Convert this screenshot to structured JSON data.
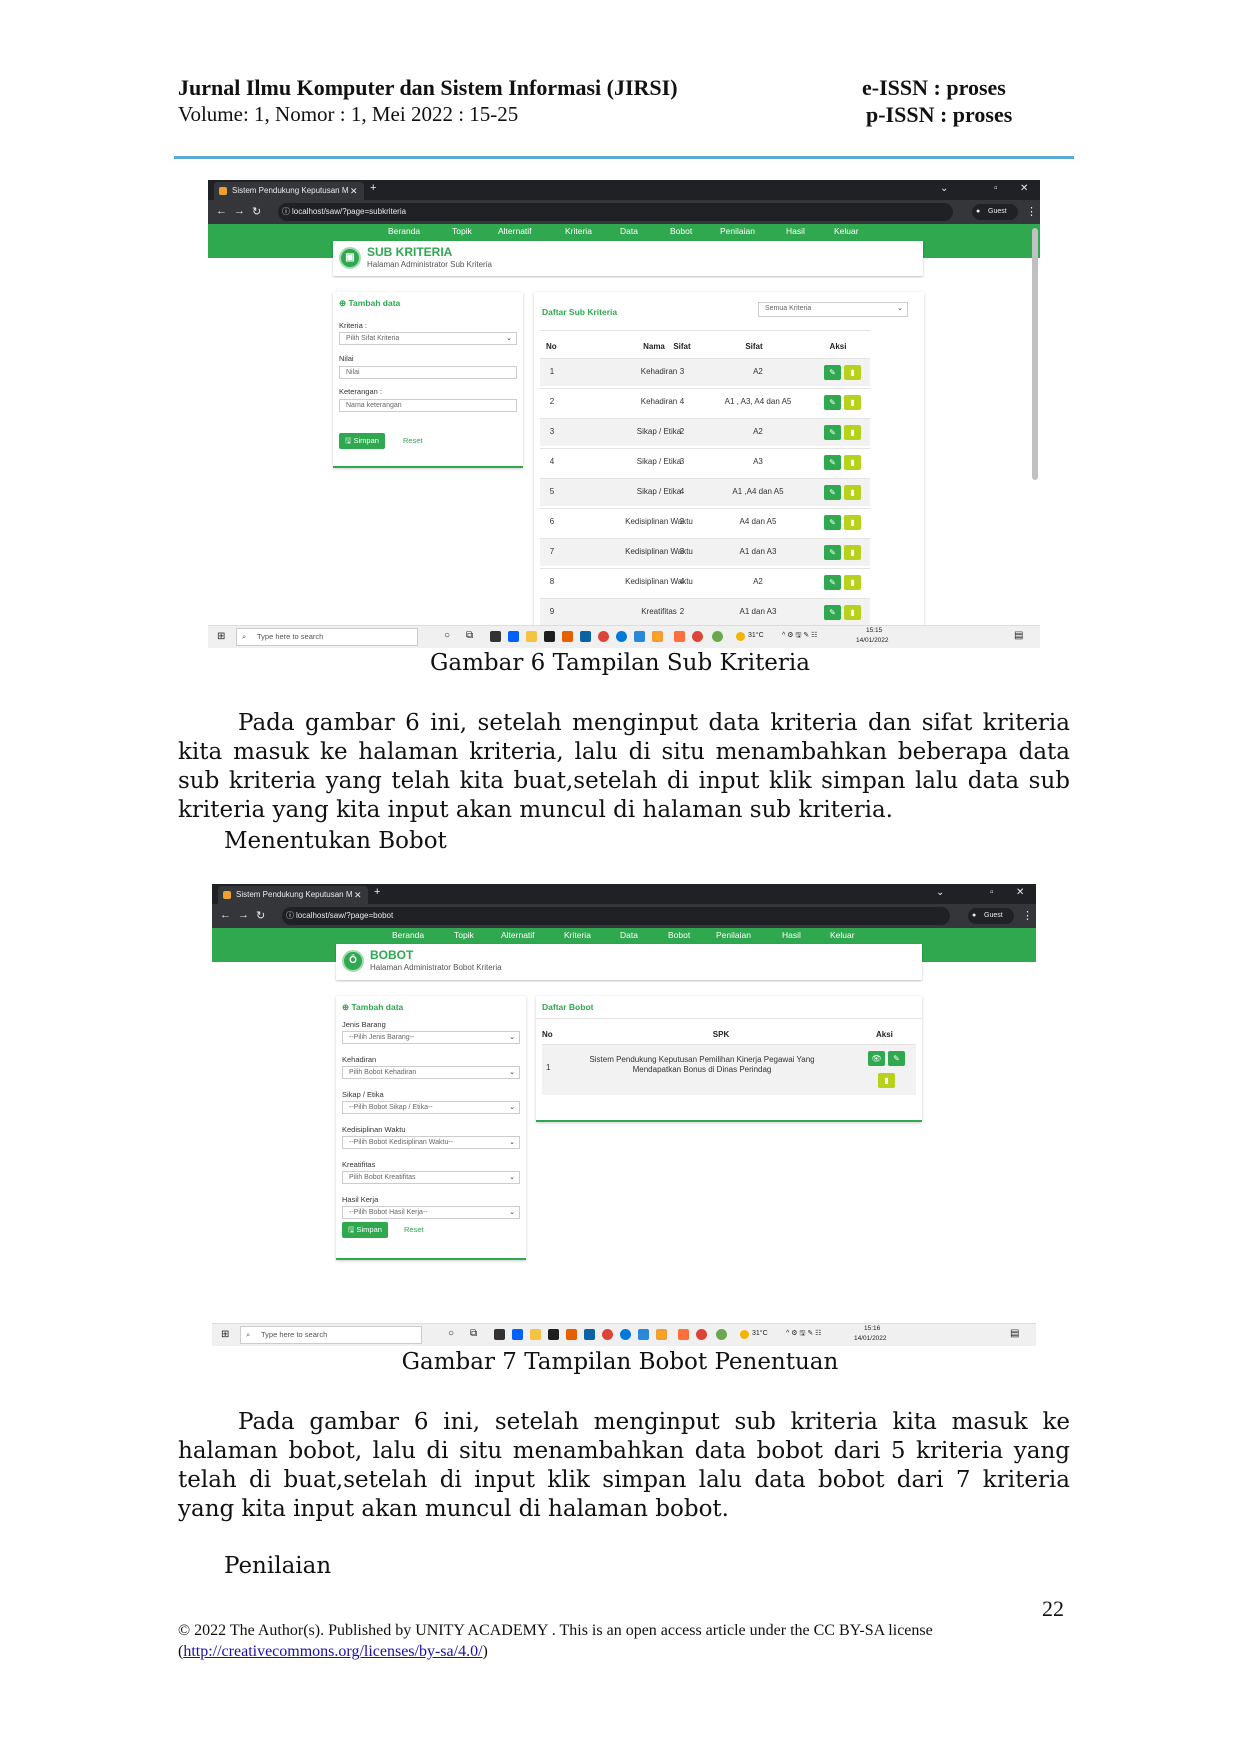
{
  "header": {
    "journal": "Jurnal Ilmu Komputer dan Sistem Informasi (JIRSI)",
    "volume": "Volume: 1, Nomor : 1, Mei 2022 : 15-25",
    "eissn": "e-ISSN : proses",
    "pissn": "p-ISSN : proses"
  },
  "shot1": {
    "tab_title": "Sistem Pendukung Keputusan M",
    "url": "localhost/saw/?page=subkriteria",
    "profile": "Guest",
    "menu": [
      "Beranda",
      "Topik",
      "Alternatif",
      "Kriteria",
      "Data",
      "Bobot",
      "Penilaian",
      "Hasil",
      "Keluar"
    ],
    "page_title": "SUB KRITERIA",
    "page_subtitle": "Halaman Administrator Sub Kriteria",
    "form": {
      "title": "Tambah data",
      "kriteria_label": "Kriteria :",
      "kriteria_value": "Pilih Sifat Kriteria",
      "nilai_label": "Nilai",
      "nilai_placeholder": "Nilai",
      "keterangan_label": "Keterangan :",
      "keterangan_placeholder": "Nama keterangan",
      "save": "Simpan",
      "reset": "Reset"
    },
    "list_title": "Daftar Sub Kriteria",
    "filter_value": "Semua Kriteria",
    "columns": [
      "No",
      "Nama",
      "Sifat",
      "Sifat",
      "Aksi"
    ],
    "rows": [
      {
        "no": "1",
        "nama": "Kehadiran",
        "nilai": "3",
        "sifat": "A2"
      },
      {
        "no": "2",
        "nama": "Kehadiran",
        "nilai": "4",
        "sifat": "A1 , A3, A4 dan A5"
      },
      {
        "no": "3",
        "nama": "Sikap / Etika",
        "nilai": "2",
        "sifat": "A2"
      },
      {
        "no": "4",
        "nama": "Sikap / Etika",
        "nilai": "3",
        "sifat": "A3"
      },
      {
        "no": "5",
        "nama": "Sikap / Etika",
        "nilai": "4",
        "sifat": "A1 ,A4 dan A5"
      },
      {
        "no": "6",
        "nama": "Kedisiplinan Waktu",
        "nilai": "2",
        "sifat": "A4 dan A5"
      },
      {
        "no": "7",
        "nama": "Kedisiplinan Waktu",
        "nilai": "3",
        "sifat": "A1 dan A3"
      },
      {
        "no": "8",
        "nama": "Kedisiplinan Waktu",
        "nilai": "4",
        "sifat": "A2"
      },
      {
        "no": "9",
        "nama": "Kreatifitas",
        "nilai": "2",
        "sifat": "A1 dan A3"
      }
    ],
    "taskbar": {
      "search": "Type here to search",
      "temp": "31°C",
      "time": "15:15",
      "date": "14/01/2022"
    }
  },
  "caption1": "Gambar 6 Tampilan Sub Kriteria",
  "para1": "Pada gambar 6 ini, setelah menginput data kriteria dan sifat kriteria kita masuk ke halaman kriteria, lalu di situ  menambahkan beberapa data sub kriteria yang telah kita buat,setelah di input klik simpan lalu data sub kriteria yang kita input akan muncul di halaman sub kriteria.",
  "heading1": "Menentukan Bobot",
  "shot2": {
    "tab_title": "Sistem Pendukung Keputusan M",
    "url": "localhost/saw/?page=bobot",
    "profile": "Guest",
    "menu": [
      "Beranda",
      "Topik",
      "Alternatif",
      "Kriteria",
      "Data",
      "Bobot",
      "Penilaian",
      "Hasil",
      "Keluar"
    ],
    "page_title": "BOBOT",
    "page_subtitle": "Halaman Administrator Bobot Kriteria",
    "form": {
      "title": "Tambah data",
      "fields": [
        {
          "label": "Jenis Barang",
          "value": "--Pilih Jenis Barang--"
        },
        {
          "label": "Kehadiran",
          "value": "Pilih Bobot Kehadiran"
        },
        {
          "label": "Sikap / Etika",
          "value": "--Pilih Bobot Sikap / Etika--"
        },
        {
          "label": "Kedisiplinan Waktu",
          "value": "--Pilih Bobot Kedisiplinan Waktu--"
        },
        {
          "label": "Kreatifitas",
          "value": "Pilih Bobot Kreatifitas"
        },
        {
          "label": "Hasil Kerja",
          "value": "--Pilih Bobot Hasil Kerja--"
        }
      ],
      "save": "Simpan",
      "reset": "Reset"
    },
    "list_title": "Daftar Bobot",
    "columns": [
      "No",
      "SPK",
      "Aksi"
    ],
    "row": {
      "no": "1",
      "spk": "Sistem Pendukung Keputusan Pemilihan Kinerja Pegawai Yang Mendapatkan Bonus di Dinas Perindag"
    },
    "taskbar": {
      "search": "Type here to search",
      "temp": "31°C",
      "time": "15:16",
      "date": "14/01/2022"
    }
  },
  "caption2": "Gambar 7 Tampilan  Bobot Penentuan",
  "para2": "Pada gambar 6 ini, setelah menginput sub kriteria kita masuk ke halaman bobot, lalu di situ  menambahkan  data bobot dari 5 kriteria yang telah di buat,setelah di input klik simpan lalu data bobot dari 7 kriteria yang kita input akan muncul di halaman bobot.",
  "heading2": "Penilaian",
  "page_number": "22",
  "footer": {
    "license": "© 2022 The Author(s). Published by UNITY ACADEMY . This is an open access article under the CC BY-SA license",
    "link_open": "(",
    "link": "http://creativecommons.org/licenses/by-sa/4.0/",
    "link_close": ")"
  }
}
